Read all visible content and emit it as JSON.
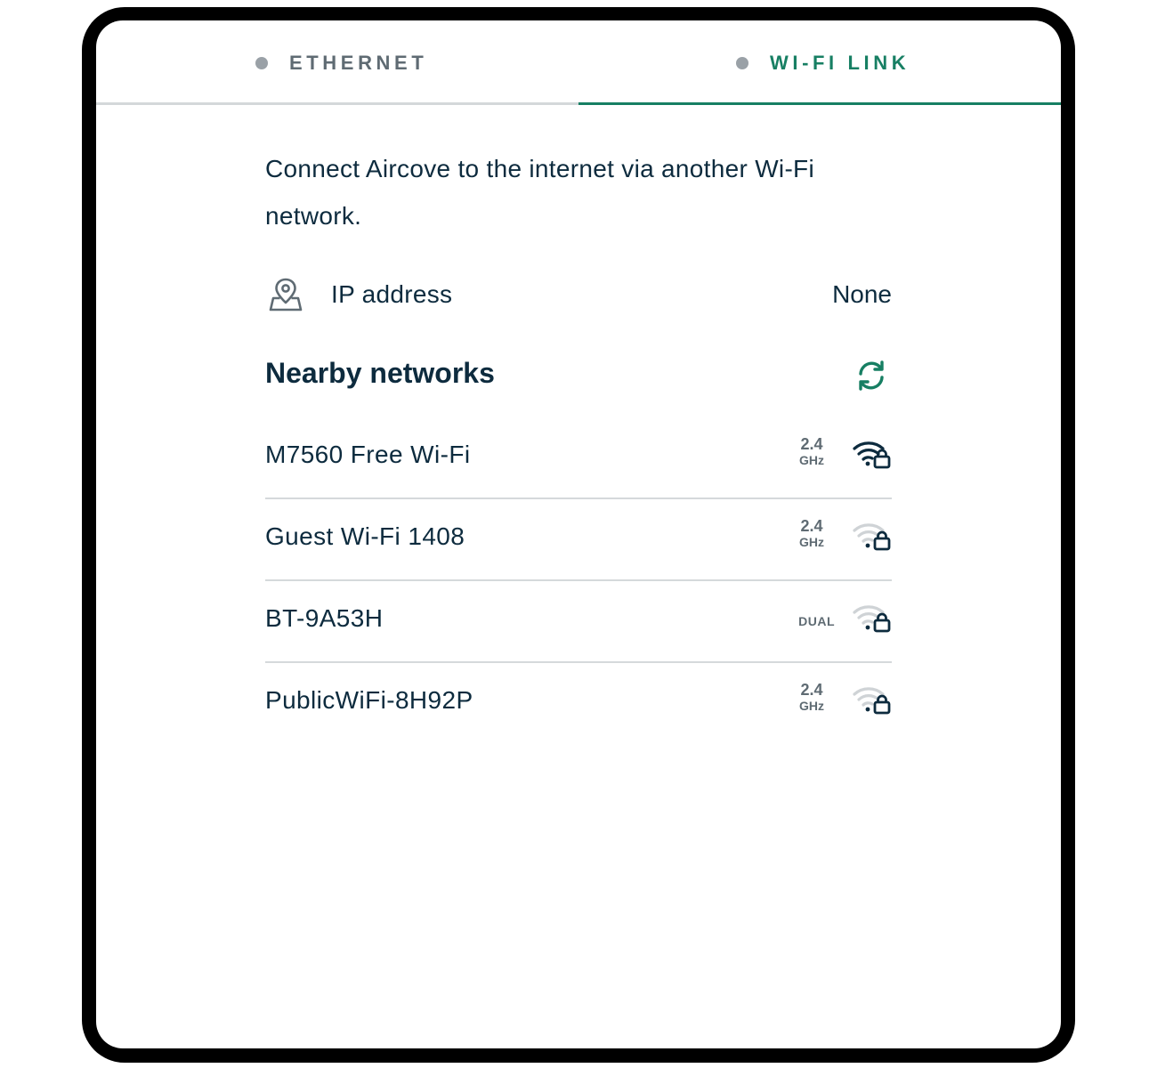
{
  "tabs": [
    {
      "label": "ETHERNET",
      "active": false
    },
    {
      "label": "WI-FI LINK",
      "active": true
    }
  ],
  "intro": "Connect Aircove to the internet via another Wi-Fi network.",
  "ip": {
    "icon": "location-pin-icon",
    "label": "IP address",
    "value": "None"
  },
  "nearby": {
    "title": "Nearby networks",
    "refresh_icon": "refresh-icon"
  },
  "networks": [
    {
      "name": "M7560 Free Wi-Fi",
      "band_num": "2.4",
      "band_unit": "GHz",
      "band_dual": "",
      "signal": "strong",
      "secured": true
    },
    {
      "name": "Guest Wi-Fi 1408",
      "band_num": "2.4",
      "band_unit": "GHz",
      "band_dual": "",
      "signal": "weak",
      "secured": true
    },
    {
      "name": "BT-9A53H",
      "band_num": "",
      "band_unit": "",
      "band_dual": "DUAL",
      "signal": "weak",
      "secured": true
    },
    {
      "name": "PublicWiFi-8H92P",
      "band_num": "2.4",
      "band_unit": "GHz",
      "band_dual": "",
      "signal": "weak",
      "secured": true
    }
  ],
  "colors": {
    "accent": "#177f63",
    "text": "#0d2b3e",
    "muted": "#5f6b73",
    "divider": "#d5d9db",
    "frame": "#000000"
  }
}
